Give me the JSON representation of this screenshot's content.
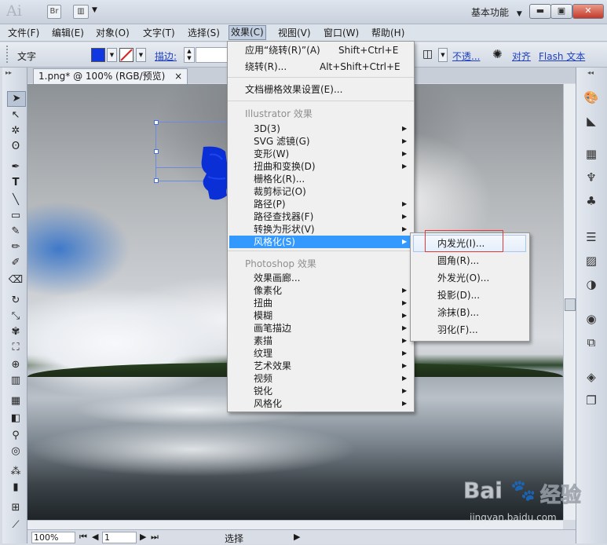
{
  "titlebar": {
    "logo": "Ai",
    "bridge_label": "Br",
    "workspace": "基本功能",
    "workspace_arrow": "▼"
  },
  "menubar": {
    "items": [
      "文件(F)",
      "编辑(E)",
      "对象(O)",
      "文字(T)",
      "选择(S)",
      "效果(C)",
      "视图(V)",
      "窗口(W)",
      "帮助(H)"
    ],
    "active": "效果(C)"
  },
  "controlbar": {
    "tool_label": "文字",
    "fill_color": "#1037e0",
    "stroke_label": "描边:",
    "opacity_label": "不透...",
    "align_label": "对齐",
    "flash_label": "Flash 文本"
  },
  "document_tab": {
    "title": "1.png* @ 100% (RGB/预览)",
    "close": "×"
  },
  "effect_menu": {
    "apply_last": {
      "label": "应用“绕转(R)”(A)",
      "shortcut": "Shift+Ctrl+E"
    },
    "last_effect": {
      "label": "绕转(R)...",
      "shortcut": "Alt+Shift+Ctrl+E"
    },
    "raster_settings": "文档栅格效果设置(E)...",
    "illustrator_header": "Illustrator 效果",
    "illustrator_items": [
      "3D(3)",
      "SVG 滤镜(G)",
      "变形(W)",
      "扭曲和变换(D)",
      "栅格化(R)...",
      "裁剪标记(O)",
      "路径(P)",
      "路径查找器(F)",
      "转换为形状(V)",
      "风格化(S)"
    ],
    "photoshop_header": "Photoshop 效果",
    "photoshop_items": [
      "效果画廊...",
      "像素化",
      "扭曲",
      "模糊",
      "画笔描边",
      "素描",
      "纹理",
      "艺术效果",
      "视频",
      "锐化",
      "风格化"
    ]
  },
  "stylize_submenu": {
    "items": [
      "内发光(I)...",
      "圆角(R)...",
      "外发光(O)...",
      "投影(D)...",
      "涂抹(B)...",
      "羽化(F)..."
    ],
    "highlighted": "内发光(I)..."
  },
  "statusbar": {
    "zoom": "100%",
    "page": "1",
    "mode": "选择"
  },
  "watermark": {
    "brand": "Bai",
    "brand_suffix": "经验",
    "url": "jingyan.baidu.com"
  },
  "colors": {
    "menu_highlight": "#3399ff",
    "fill_swatch": "#1037e0",
    "annotation_box": "#e23a3a"
  }
}
